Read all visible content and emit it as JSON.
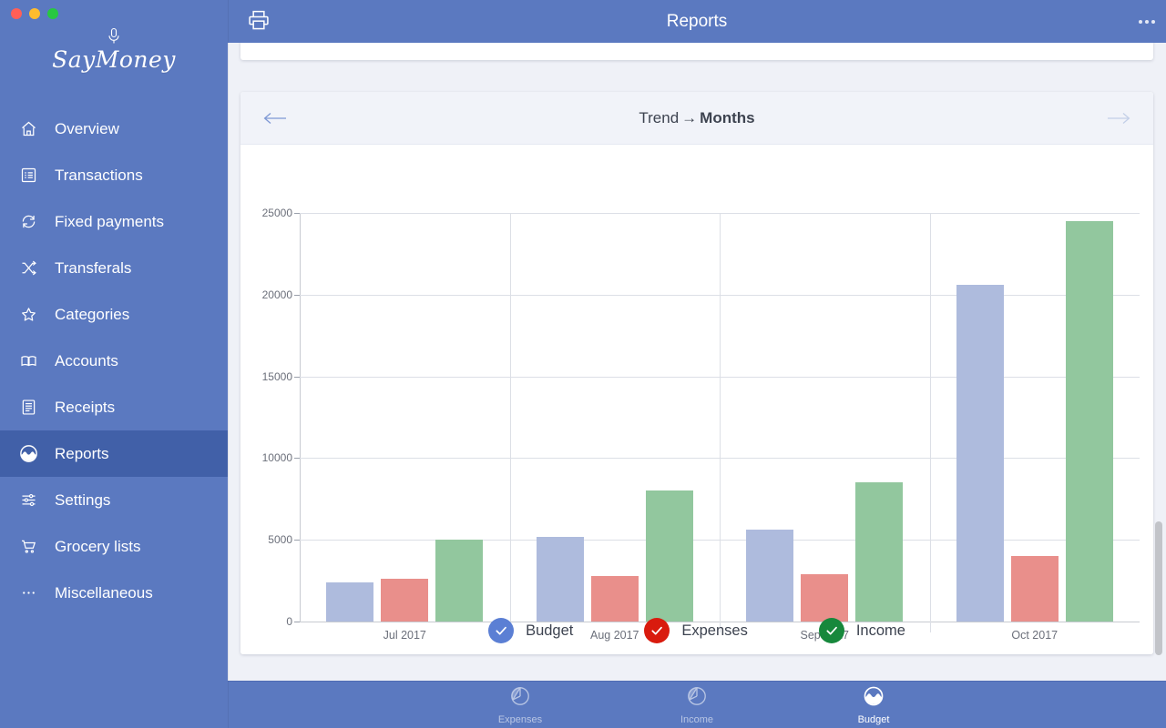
{
  "window": {
    "traffic_lights": [
      "close",
      "minimize",
      "zoom"
    ],
    "colors": {
      "sidebar": "#5b79c0",
      "sidebar_active": "#4160a8",
      "canvas": "#eff1f7",
      "budget": "#aebbdd",
      "expenses": "#e98f8b",
      "income": "#92c79e",
      "legend_budget": "#5b7fd4",
      "legend_expenses": "#d91b0e",
      "legend_income": "#17883c"
    }
  },
  "brand": {
    "name": "SayMoney",
    "icon": "microphone-icon"
  },
  "sidebar": {
    "items": [
      {
        "label": "Overview",
        "icon": "home-icon",
        "active": false
      },
      {
        "label": "Transactions",
        "icon": "list-icon",
        "active": false
      },
      {
        "label": "Fixed payments",
        "icon": "refresh-icon",
        "active": false
      },
      {
        "label": "Transferals",
        "icon": "shuffle-icon",
        "active": false
      },
      {
        "label": "Categories",
        "icon": "star-icon",
        "active": false
      },
      {
        "label": "Accounts",
        "icon": "book-icon",
        "active": false
      },
      {
        "label": "Receipts",
        "icon": "receipt-icon",
        "active": false
      },
      {
        "label": "Reports",
        "icon": "report-wave-icon",
        "active": true
      },
      {
        "label": "Settings",
        "icon": "sliders-icon",
        "active": false
      },
      {
        "label": "Grocery lists",
        "icon": "cart-icon",
        "active": false
      },
      {
        "label": "Miscellaneous",
        "icon": "ellipsis-icon",
        "active": false
      }
    ]
  },
  "topbar": {
    "title": "Reports",
    "print_icon": "printer-icon",
    "more_icon": "ellipsis-icon"
  },
  "chart_card": {
    "title_prefix": "Trend",
    "title_arrow": "→",
    "title_suffix": "Months",
    "prev_icon": "arrow-left-icon",
    "next_icon": "arrow-right-icon"
  },
  "chart_data": {
    "type": "bar",
    "title": "Trend → Months",
    "xlabel": "",
    "ylabel": "",
    "grid": true,
    "legend_position": "bottom",
    "ylim": [
      0,
      25000
    ],
    "yticks": [
      0,
      5000,
      10000,
      15000,
      20000,
      25000
    ],
    "ytick_labels": [
      "0",
      "5000",
      "10000",
      "15000",
      "20000",
      "25000"
    ],
    "categories": [
      "Jul 2017",
      "Aug 2017",
      "Sep 2017",
      "Oct 2017"
    ],
    "series": [
      {
        "name": "Budget",
        "color": "#aebbdd",
        "values": [
          2400,
          5200,
          5600,
          20600
        ]
      },
      {
        "name": "Expenses",
        "color": "#e98f8b",
        "values": [
          2600,
          2800,
          2900,
          4000
        ]
      },
      {
        "name": "Income",
        "color": "#92c79e",
        "values": [
          5000,
          8000,
          8500,
          24500
        ]
      }
    ]
  },
  "legend": {
    "items": [
      {
        "label": "Budget",
        "color": "#5b7fd4",
        "icon": "check-circle-icon",
        "checked": true
      },
      {
        "label": "Expenses",
        "color": "#d91b0e",
        "icon": "check-circle-icon",
        "checked": true
      },
      {
        "label": "Income",
        "color": "#17883c",
        "icon": "check-circle-icon",
        "checked": true
      }
    ]
  },
  "tabbar": {
    "tabs": [
      {
        "label": "Expenses",
        "icon": "pie-chart-icon",
        "active": false
      },
      {
        "label": "Income",
        "icon": "pie-chart-icon",
        "active": false
      },
      {
        "label": "Budget",
        "icon": "wave-circle-icon",
        "active": true
      }
    ]
  }
}
